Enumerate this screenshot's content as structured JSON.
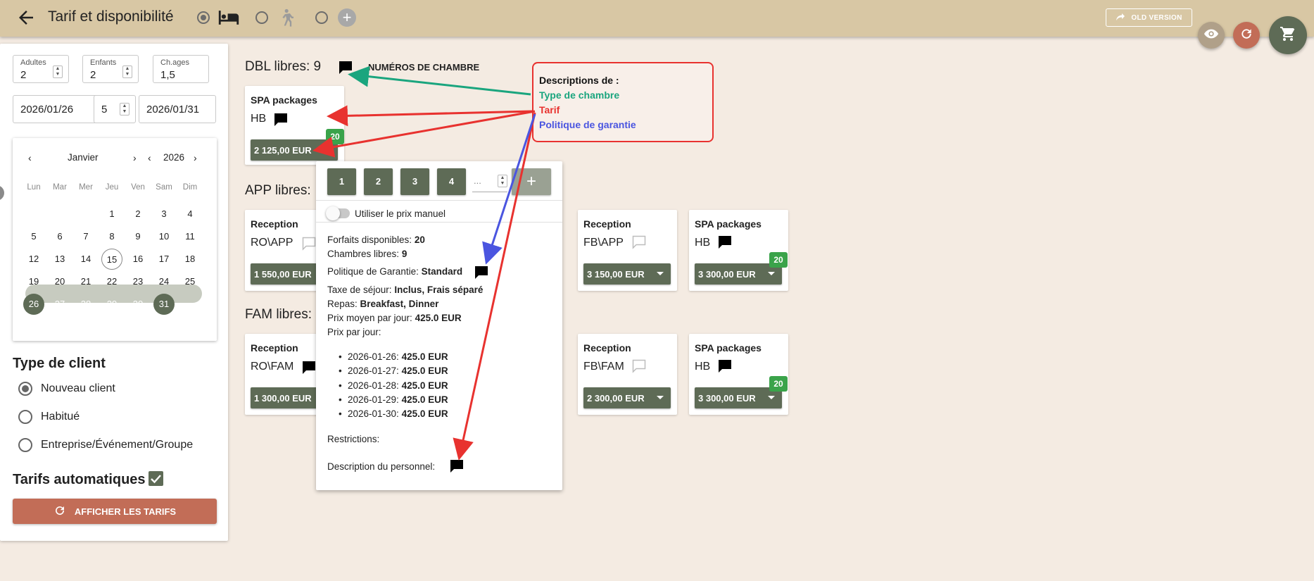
{
  "header": {
    "title": "Tarif et disponibilité",
    "old_version": "OLD VERSION"
  },
  "search": {
    "adults_label": "Adultes",
    "adults": "2",
    "children_label": "Enfants",
    "children": "2",
    "ages_label": "Ch.ages",
    "ages": "1,5",
    "date_from": "2026/01/26",
    "nights": "5",
    "date_to": "2026/01/31"
  },
  "calendar": {
    "month": "Janvier",
    "year": "2026",
    "weekdays": [
      "Lun",
      "Mar",
      "Mer",
      "Jeu",
      "Ven",
      "Sam",
      "Dim"
    ],
    "rows": [
      [
        "",
        "",
        "",
        "1",
        "2",
        "3",
        "4"
      ],
      [
        "5",
        "6",
        "7",
        "8",
        "9",
        "10",
        "11"
      ],
      [
        "12",
        "13",
        "14",
        "15",
        "16",
        "17",
        "18"
      ],
      [
        "19",
        "20",
        "21",
        "22",
        "23",
        "24",
        "25"
      ],
      [
        "26",
        "27",
        "28",
        "29",
        "30",
        "31",
        ""
      ]
    ]
  },
  "client": {
    "heading": "Type de client",
    "options": [
      "Nouveau client",
      "Habitué",
      "Entreprise/Événement/Groupe"
    ],
    "selected": "Nouveau client"
  },
  "auto": {
    "label": "Tarifs automatiques",
    "checked": true
  },
  "show_btn": "AFFICHER LES TARIFS",
  "sections": {
    "dbl": {
      "title": "DBL libres: 9",
      "room_numbers": "NUMÉROS DE CHAMBRE"
    },
    "app": {
      "title": "APP libres:"
    },
    "fam": {
      "title": "FAM libres:"
    }
  },
  "cards": {
    "dbl_spa": {
      "name": "SPA packages",
      "code": "HB",
      "price": "2 125,00 EUR",
      "badge": "20"
    },
    "app_reception": {
      "name": "Reception",
      "code": "RO\\APP",
      "price": "1 550,00 EUR"
    },
    "app_fb": {
      "name": "Reception",
      "code": "FB\\APP",
      "price": "3 150,00 EUR"
    },
    "app_spa": {
      "name": "SPA packages",
      "code": "HB",
      "price": "3 300,00 EUR",
      "badge": "20"
    },
    "fam_reception": {
      "name": "Reception",
      "code": "RO\\FAM",
      "price": "1 300,00 EUR"
    },
    "fam_fb": {
      "name": "Reception",
      "code": "FB\\FAM",
      "price": "2 300,00 EUR"
    },
    "fam_spa": {
      "name": "SPA packages",
      "code": "HB",
      "price": "3 300,00 EUR",
      "badge": "20"
    }
  },
  "popup": {
    "nums": [
      "1",
      "2",
      "3",
      "4"
    ],
    "qty_placeholder": "...",
    "manual_label": "Utiliser le prix manuel",
    "forfaits_label": "Forfaits disponibles:",
    "forfaits": "20",
    "chambres_label": "Chambres libres:",
    "chambres": "9",
    "garantie_label": "Politique de Garantie:",
    "garantie": "Standard",
    "taxe_label": "Taxe de séjour:",
    "taxe": "Inclus, Frais séparé",
    "repas_label": "Repas:",
    "repas": "Breakfast, Dinner",
    "moyen_label": "Prix moyen par jour:",
    "moyen": "425.0 EUR",
    "par_jour_label": "Prix par jour:",
    "days": [
      {
        "date": "2026-01-26:",
        "price": "425.0 EUR"
      },
      {
        "date": "2026-01-27:",
        "price": "425.0 EUR"
      },
      {
        "date": "2026-01-28:",
        "price": "425.0 EUR"
      },
      {
        "date": "2026-01-29:",
        "price": "425.0 EUR"
      },
      {
        "date": "2026-01-30:",
        "price": "425.0 EUR"
      }
    ],
    "restrictions_label": "Restrictions:",
    "personnel_label": "Description du personnel:"
  },
  "annotation": {
    "heading": "Descriptions de :",
    "line1": "Type de chambre",
    "line2": "Tarif",
    "line3": "Politique de garantie"
  },
  "colors": {
    "header": "#d8c7a4",
    "background": "#f4ebe2",
    "accent": "#5e6b56",
    "button": "#c26d57",
    "badge": "#3aa34a",
    "annot_green": "#1aa57e",
    "annot_red": "#e8322f",
    "annot_blue": "#4a55e0"
  }
}
